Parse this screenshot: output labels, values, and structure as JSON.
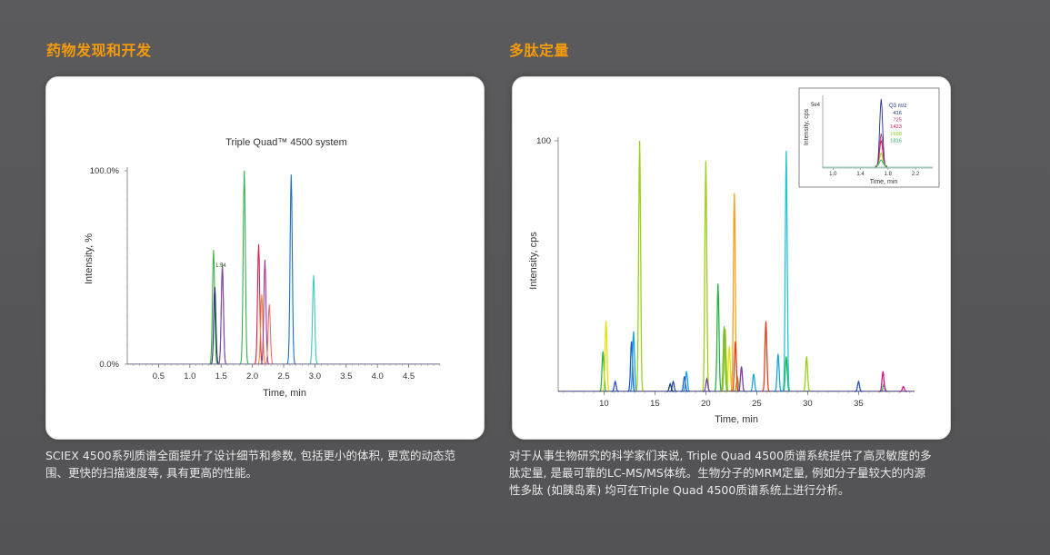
{
  "left": {
    "heading": "药物发现和开发",
    "caption_line1": "SCIEX 4500系列质谱全面提升了设计细节和参数, 包括更小的体积, 更宽的动态范",
    "caption_line2": "围、更快的扫描速度等, 具有更高的性能。",
    "chart_data": {
      "type": "line",
      "title": "Triple Quad™ 4500 system",
      "xlabel": "Time, min",
      "ylabel": "Intensity, %",
      "xlim": [
        0.0,
        5.0
      ],
      "ylim": [
        0,
        100
      ],
      "x_ticks": [
        "0.5",
        "1.0",
        "1.5",
        "2.0",
        "2.5",
        "3.0",
        "3.5",
        "4.0",
        "4.5"
      ],
      "y_ticks": [
        "100.0%",
        "0.0%"
      ],
      "annotation": "1.54",
      "series": [
        {
          "color": "#3cb043",
          "peaks": [
            {
              "x": 1.38,
              "y": 59
            },
            {
              "x": 1.52,
              "y": 52
            }
          ]
        },
        {
          "color": "#1f2a6e",
          "peaks": [
            {
              "x": 1.4,
              "y": 40
            }
          ]
        },
        {
          "color": "#8e3fb0",
          "peaks": [
            {
              "x": 1.52,
              "y": 50
            }
          ]
        },
        {
          "color": "#33b34a",
          "peaks": [
            {
              "x": 1.87,
              "y": 100
            }
          ]
        },
        {
          "color": "#e0194a",
          "peaks": [
            {
              "x": 2.1,
              "y": 62
            }
          ]
        },
        {
          "color": "#f08c2a",
          "peaks": [
            {
              "x": 2.15,
              "y": 36
            }
          ]
        },
        {
          "color": "#9c3d9c",
          "peaks": [
            {
              "x": 2.2,
              "y": 54
            }
          ]
        },
        {
          "color": "#f26d6d",
          "peaks": [
            {
              "x": 2.27,
              "y": 31
            }
          ]
        },
        {
          "color": "#1a6fc9",
          "peaks": [
            {
              "x": 2.62,
              "y": 98
            }
          ]
        },
        {
          "color": "#3ec7c0",
          "peaks": [
            {
              "x": 2.98,
              "y": 46
            }
          ]
        }
      ]
    }
  },
  "right": {
    "heading": "多肽定量",
    "caption_line1": "对于从事生物研究的科学家们来说, Triple Quad 4500质谱系统提供了高灵敏度的多",
    "caption_line2": "肽定量, 是最可靠的LC-MS/MS体统。生物分子的MRM定量, 例如分子量较大的内源",
    "caption_line3": "性多肽 (如胰岛素) 均可在Triple Quad 4500质谱系统上进行分析。",
    "chart_data": {
      "type": "line",
      "xlabel": "Time, min",
      "ylabel": "Intensity, cps",
      "xlim": [
        5.5,
        40.5
      ],
      "ylim": [
        0,
        100
      ],
      "x_ticks": [
        "10",
        "15",
        "20",
        "25",
        "30",
        "35"
      ],
      "y_ticks": [
        "100"
      ],
      "series": [
        {
          "color": "#2db34a",
          "peaks": [
            {
              "x": 9.9,
              "y": 16
            },
            {
              "x": 21.2,
              "y": 43
            },
            {
              "x": 27.9,
              "y": 14
            },
            {
              "x": 37.5,
              "y": 3
            }
          ]
        },
        {
          "color": "#e8e000",
          "peaks": [
            {
              "x": 10.2,
              "y": 28
            },
            {
              "x": 22.3,
              "y": 18
            }
          ]
        },
        {
          "color": "#2a54c8",
          "peaks": [
            {
              "x": 11.1,
              "y": 4
            },
            {
              "x": 12.7,
              "y": 20
            },
            {
              "x": 16.8,
              "y": 4
            },
            {
              "x": 17.9,
              "y": 6
            },
            {
              "x": 35.0,
              "y": 4
            }
          ]
        },
        {
          "color": "#1ba7d8",
          "peaks": [
            {
              "x": 12.9,
              "y": 24
            },
            {
              "x": 18.1,
              "y": 8
            },
            {
              "x": 24.7,
              "y": 7
            },
            {
              "x": 27.1,
              "y": 15
            }
          ]
        },
        {
          "color": "#9ad11a",
          "peaks": [
            {
              "x": 13.5,
              "y": 100
            },
            {
              "x": 20.0,
              "y": 92
            },
            {
              "x": 21.9,
              "y": 25
            },
            {
              "x": 29.9,
              "y": 14
            }
          ]
        },
        {
          "color": "#17406e",
          "peaks": [
            {
              "x": 16.5,
              "y": 3
            }
          ]
        },
        {
          "color": "#7ab63a",
          "peaks": [
            {
              "x": 21.8,
              "y": 26
            },
            {
              "x": 23.1,
              "y": 6
            }
          ]
        },
        {
          "color": "#f7a21b",
          "peaks": [
            {
              "x": 22.8,
              "y": 79
            }
          ]
        },
        {
          "color": "#e8401c",
          "peaks": [
            {
              "x": 22.9,
              "y": 20
            },
            {
              "x": 25.9,
              "y": 28
            }
          ]
        },
        {
          "color": "#7b3ea8",
          "peaks": [
            {
              "x": 23.5,
              "y": 10
            },
            {
              "x": 20.1,
              "y": 5
            }
          ]
        },
        {
          "color": "#22c4d8",
          "peaks": [
            {
              "x": 27.9,
              "y": 96
            }
          ]
        },
        {
          "color": "#d01c8b",
          "peaks": [
            {
              "x": 37.4,
              "y": 8
            },
            {
              "x": 39.4,
              "y": 2
            }
          ]
        }
      ]
    },
    "inset": {
      "ylabel": "Intensity, cps",
      "y_tick": "5e4",
      "xlabel": "Time, min",
      "x_ticks": [
        "1.0",
        "1.4",
        "1.8",
        "2.2"
      ],
      "xlim": [
        0.85,
        2.45
      ],
      "legend_title": "Q3 m/z",
      "series": [
        {
          "name": "416",
          "color": "#1f2f8a",
          "peak": {
            "x": 1.7,
            "y": 100
          }
        },
        {
          "name": "725",
          "color": "#b0307a",
          "peak": {
            "x": 1.7,
            "y": 50
          }
        },
        {
          "name": "1423",
          "color": "#e0194a",
          "peak": {
            "x": 1.7,
            "y": 40
          }
        },
        {
          "name": "1698",
          "color": "#8acb2b",
          "peak": {
            "x": 1.7,
            "y": 22
          }
        },
        {
          "name": "1816",
          "color": "#27a86a",
          "peak": {
            "x": 1.7,
            "y": 12
          }
        }
      ]
    }
  }
}
